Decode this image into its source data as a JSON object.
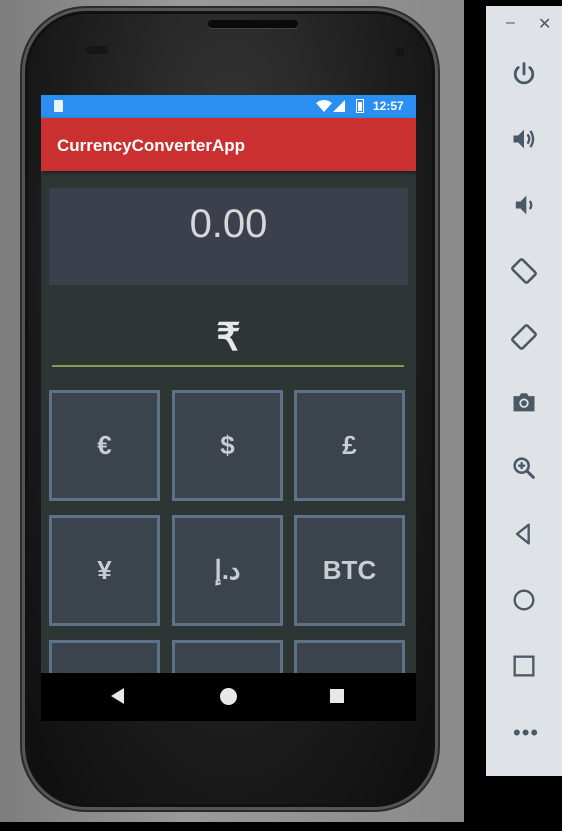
{
  "status_bar": {
    "time": "12:57"
  },
  "app": {
    "title": "CurrencyConverterApp"
  },
  "converter": {
    "display_value": "0.00",
    "selected_currency_symbol": "₹"
  },
  "keypad": {
    "keys": [
      {
        "label": "€",
        "name": "currency-key-euro"
      },
      {
        "label": "$",
        "name": "currency-key-dollar"
      },
      {
        "label": "£",
        "name": "currency-key-pound"
      },
      {
        "label": "¥",
        "name": "currency-key-yen"
      },
      {
        "label": "د.إ",
        "name": "currency-key-dirham"
      },
      {
        "label": "BTC",
        "name": "currency-key-btc"
      }
    ]
  },
  "nav_bar": {
    "icons": [
      "back-icon",
      "home-icon",
      "recents-icon"
    ]
  },
  "emulator_toolbar": {
    "buttons": [
      "power-icon",
      "volume-up-icon",
      "volume-down-icon",
      "rotate-left-icon",
      "rotate-right-icon",
      "camera-icon",
      "zoom-icon",
      "back-icon",
      "home-icon",
      "overview-icon",
      "more-icon"
    ]
  },
  "colors": {
    "status_bar": "#2a8ff0",
    "app_bar": "#c9302f",
    "screen_bg": "#2e3535",
    "display_bg": "#3c404c",
    "key_border": "#5e7287",
    "key_bg": "#3b434c",
    "underline": "#8a9a5b"
  }
}
